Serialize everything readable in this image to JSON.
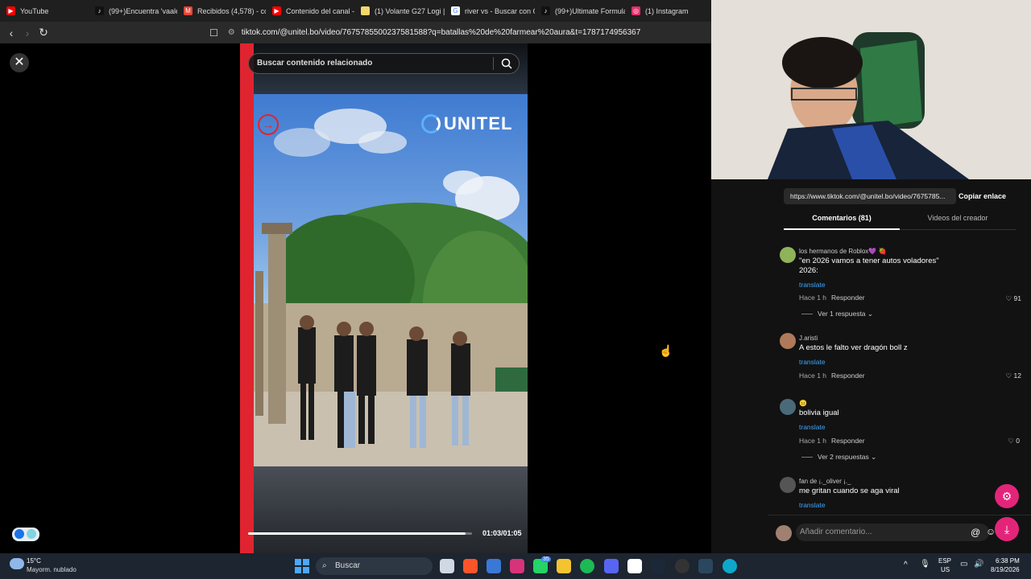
{
  "browser": {
    "tabs": [
      {
        "label": "YouTube",
        "color": "#ff0000",
        "icon": "youtube-icon"
      },
      {
        "label": "(99+)Encuentra 'vaalen",
        "color": "#111111",
        "icon": "tiktok-icon"
      },
      {
        "label": "Recibidos (4,578) - co",
        "color": "#ea4335",
        "icon": "gmail-icon"
      },
      {
        "label": "Contenido del canal -",
        "color": "#ff0000",
        "icon": "youtube-studio-icon"
      },
      {
        "label": "(1) Volante G27 Logi |",
        "color": "#f5d76e",
        "icon": "marketplace-icon"
      },
      {
        "label": "river vs - Buscar con G",
        "color": "#4285f4",
        "icon": "google-icon"
      },
      {
        "label": "(99+)Ultimate Formula",
        "color": "#111111",
        "icon": "tiktok-icon"
      },
      {
        "label": "(1) Instagram",
        "color": "#e1306c",
        "icon": "instagram-icon"
      }
    ],
    "url": "tiktok.com/@unitel.bo/video/7675785500237581588?q=batallas%20de%20farmear%20aura&t=1787174956367"
  },
  "player": {
    "search_placeholder": "Buscar contenido relacionado",
    "logo_text": "UNITEL",
    "timecode": "01:03/01:05",
    "progress": 0.97
  },
  "share": {
    "url": "https://www.tiktok.com/@unitel.bo/video/7675785...",
    "copy_label": "Copiar enlace"
  },
  "panel_tabs": {
    "comments": "Comentarios (81)",
    "creator": "Videos del creador"
  },
  "comments": [
    {
      "user": "los hermanos de Roblox💜 🍓",
      "text": "\"en 2026 vamos a tener autos voladores\" 2026:",
      "translate": "translate",
      "time": "Hace 1 h",
      "reply": "Responder",
      "likes": "91",
      "replies": "Ver 1 respuesta",
      "avatar_color": "#8fb35a"
    },
    {
      "user": "J.aristi",
      "text": "A estos le falto ver dragón boll z",
      "translate": "translate",
      "time": "Hace 1 h",
      "reply": "Responder",
      "likes": "12",
      "replies": "",
      "avatar_color": "#b07a5a"
    },
    {
      "user": "😐",
      "text": "bolivia igual",
      "translate": "translate",
      "time": "Hace 1 h",
      "reply": "Responder",
      "likes": "0",
      "replies": "Ver 2 respuestas",
      "avatar_color": "#4a6a7a"
    },
    {
      "user": "fan de ¡._oliver ¡._",
      "text": "me gritan cuando se aga viral",
      "translate": "translate",
      "time": "",
      "reply": "",
      "likes": "",
      "replies": "",
      "avatar_color": "#555555"
    }
  ],
  "comment_input": {
    "placeholder": "Añadir comentario..."
  },
  "taskbar": {
    "weather_temp": "15°C",
    "weather_desc": "Mayorm. nublado",
    "search_label": "Buscar",
    "lang": "ESP",
    "region": "US",
    "time": "6:38 PM",
    "date": "8/19/2026",
    "whatsapp_badge": "35"
  }
}
